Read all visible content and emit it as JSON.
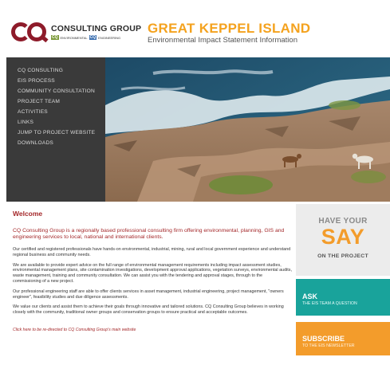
{
  "header": {
    "brand_name": "CONSULTING GROUP",
    "brand_mark": "CQ",
    "brand_sub_env_badge": "CQ",
    "brand_sub_env_label": "ENVIRONMENTAL",
    "brand_sub_eng_badge": "CQ",
    "brand_sub_eng_label": "ENGINEERING",
    "project_title": "GREAT KEPPEL ISLAND",
    "project_subtitle": "Environmental Impact Statement Information"
  },
  "nav": {
    "items": [
      {
        "label": "CQ CONSULTING"
      },
      {
        "label": "EIS PROCESS"
      },
      {
        "label": "COMMUNITY CONSULTATION"
      },
      {
        "label": "PROJECT TEAM"
      },
      {
        "label": "ACTIVITIES"
      },
      {
        "label": "LINKS"
      },
      {
        "label": "JUMP TO PROJECT WEBSITE"
      },
      {
        "label": "DOWNLOADS"
      }
    ]
  },
  "main": {
    "heading": "Welcome",
    "intro": "CQ Consulting Group is a regionally based professional consulting firm offering environmental, planning, GIS and engineering services to local, national and international clients.",
    "paragraphs": [
      "Our certified and registered professionals have hands-on environmental, industrial, mining, rural and local government experience and understand regional business and community needs.",
      "We are available to provide expert advice on the full range of environmental management requirements including impact assessment studies, environmental management plans, site contamination investigations, development approval applications, vegetation surveys, environmental audits, waste management, training and community consultation. We can assist you with the tendering and approval stages, through to the commissioning of a new project.",
      "Our professional engineering staff are able to offer clients services in asset management, industrial engineering, project management, \"owners engineer\", feasibility studies and due diligence assessments.",
      "We value our clients and assist them to achieve their goals through innovative and tailored solutions. CQ Consulting Group believes in working closely with the community, traditional owner groups and conservation groups to ensure practical and acceptable outcomes."
    ],
    "redirect_link": "Click here to be re-directed to CQ Consulting Group's main website"
  },
  "sidebar": {
    "say": {
      "line1": "HAVE YOUR",
      "line2": "SAY",
      "line3": "ON THE PROJECT"
    },
    "ask": {
      "title": "ASK",
      "subtitle": "THE EIS TEAM A QUESTION"
    },
    "subscribe": {
      "title": "SUBSCRIBE",
      "subtitle": "TO THE EIS NEWSLETTER"
    }
  },
  "colors": {
    "brand_red": "#8e1b2a",
    "accent_orange": "#f39c2b",
    "teal": "#19a39b",
    "nav_bg": "#3a3a3a"
  }
}
